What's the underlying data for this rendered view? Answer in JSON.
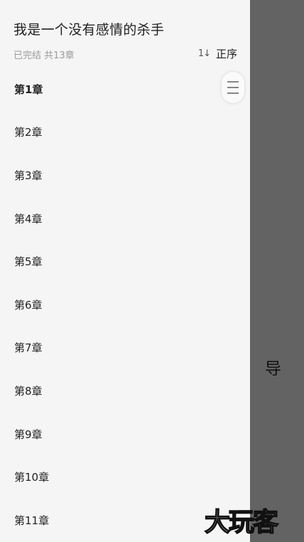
{
  "book": {
    "title": "我是一个没有感情的杀手",
    "status": "已完结 共13章"
  },
  "sort": {
    "icon": "1↓",
    "label": "正序"
  },
  "chapters": [
    {
      "label": "第1章",
      "current": true
    },
    {
      "label": "第2章"
    },
    {
      "label": "第3章"
    },
    {
      "label": "第4章"
    },
    {
      "label": "第5章"
    },
    {
      "label": "第6章"
    },
    {
      "label": "第7章"
    },
    {
      "label": "第8章"
    },
    {
      "label": "第9章"
    },
    {
      "label": "第10章"
    },
    {
      "label": "第11章"
    }
  ],
  "overlay": {
    "nav_glyph": "导"
  },
  "watermark": "大玩客",
  "colors": {
    "drawer_bg": "#f5f5f5",
    "overlay_bg": "#636363",
    "text": "#222222",
    "muted_text": "#9a9a9a"
  }
}
